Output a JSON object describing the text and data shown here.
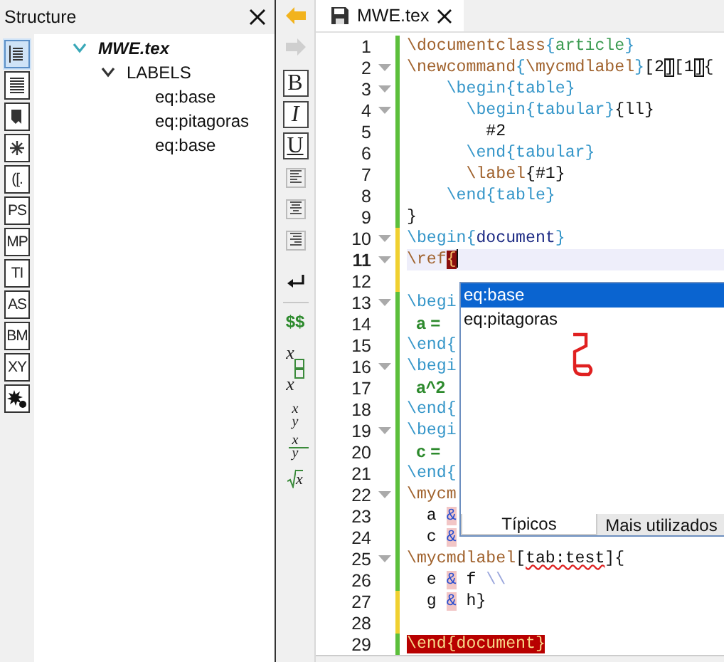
{
  "structure": {
    "title": "Structure",
    "views": [
      {
        "kind": "toc",
        "selected": true
      },
      {
        "kind": "list",
        "selected": false
      },
      {
        "kind": "bookmark",
        "selected": false
      },
      {
        "kind": "asterisk",
        "selected": false
      },
      {
        "kind": "letters",
        "label": "([.",
        "selected": false
      },
      {
        "kind": "letters",
        "label": "PS",
        "selected": false
      },
      {
        "kind": "letters",
        "label": "MP",
        "selected": false
      },
      {
        "kind": "letters",
        "label": "TI",
        "selected": false
      },
      {
        "kind": "letters",
        "label": "AS",
        "selected": false
      },
      {
        "kind": "letters",
        "label": "BM",
        "selected": false
      },
      {
        "kind": "letters",
        "label": "XY",
        "selected": false
      },
      {
        "kind": "splat",
        "selected": false
      }
    ],
    "tree": [
      {
        "label": "MWE.tex",
        "expanded": true,
        "children": [
          {
            "label": "LABELS",
            "expanded": true,
            "children": [
              {
                "label": "eq:base"
              },
              {
                "label": "eq:pitagoras"
              },
              {
                "label": "eq:base"
              }
            ]
          }
        ]
      }
    ]
  },
  "toolbar": [
    {
      "kind": "back",
      "disabled": false
    },
    {
      "kind": "forward",
      "disabled": true
    },
    {
      "kind": "bold",
      "label": "B"
    },
    {
      "kind": "italic",
      "label": "I"
    },
    {
      "kind": "underline",
      "label": "U"
    },
    {
      "kind": "align-left"
    },
    {
      "kind": "align-center"
    },
    {
      "kind": "align-right"
    },
    {
      "kind": "newline"
    },
    {
      "kind": "math",
      "label": "$$"
    },
    {
      "kind": "subscript",
      "label": "x"
    },
    {
      "kind": "superscript",
      "label": "x"
    },
    {
      "kind": "fraction",
      "numerator": "x",
      "denominator": "y"
    },
    {
      "kind": "dfrac",
      "numerator": "x",
      "denominator": "y"
    },
    {
      "kind": "sqrt",
      "label": "x"
    }
  ],
  "tabs": [
    {
      "label": "MWE.tex",
      "selected": true
    }
  ],
  "lines": [
    {
      "number": "1",
      "fold": false,
      "modified": false,
      "current": false,
      "segments": [
        {
          "kind": "command",
          "text": "\\documentclass"
        },
        {
          "kind": "environment",
          "text": "{"
        },
        {
          "kind": "argument",
          "text": "article"
        },
        {
          "kind": "environment",
          "text": "}"
        }
      ]
    },
    {
      "number": "2",
      "fold": true,
      "modified": false,
      "current": false,
      "segments": [
        {
          "kind": "command",
          "text": "\\newcommand"
        },
        {
          "kind": "environment",
          "text": "{"
        },
        {
          "kind": "command",
          "text": "\\mycmdlabel"
        },
        {
          "kind": "environment",
          "text": "}"
        },
        {
          "kind": "plain",
          "text": "[2"
        },
        {
          "kind": "match",
          "text": "]"
        },
        {
          "kind": "plain",
          "text": "[1"
        },
        {
          "kind": "match",
          "text": "]"
        },
        {
          "kind": "plain",
          "text": "{"
        }
      ]
    },
    {
      "number": "3",
      "fold": true,
      "modified": false,
      "current": false,
      "segments": [
        {
          "kind": "environment",
          "text": "    \\begin{table}"
        }
      ]
    },
    {
      "number": "4",
      "fold": true,
      "modified": false,
      "current": false,
      "segments": [
        {
          "kind": "environment",
          "text": "      \\begin{tabular}"
        },
        {
          "kind": "plain",
          "text": "{ll}"
        }
      ]
    },
    {
      "number": "5",
      "fold": false,
      "modified": false,
      "current": false,
      "segments": [
        {
          "kind": "plain",
          "text": "        #2"
        }
      ]
    },
    {
      "number": "6",
      "fold": false,
      "modified": false,
      "current": false,
      "segments": [
        {
          "kind": "environment",
          "text": "      \\end{tabular}"
        }
      ]
    },
    {
      "number": "7",
      "fold": false,
      "modified": false,
      "current": false,
      "segments": [
        {
          "kind": "command",
          "text": "      \\label"
        },
        {
          "kind": "plain",
          "text": "{#1}"
        }
      ]
    },
    {
      "number": "8",
      "fold": false,
      "modified": false,
      "current": false,
      "segments": [
        {
          "kind": "environment",
          "text": "    \\end{table}"
        }
      ]
    },
    {
      "number": "9",
      "fold": false,
      "modified": false,
      "current": false,
      "segments": [
        {
          "kind": "plain",
          "text": "}"
        }
      ]
    },
    {
      "number": "10",
      "fold": true,
      "modified": true,
      "current": false,
      "segments": [
        {
          "kind": "environment",
          "text": "\\begin{"
        },
        {
          "kind": "keyword",
          "text": "document"
        },
        {
          "kind": "environment",
          "text": "}"
        }
      ]
    },
    {
      "number": "11",
      "fold": true,
      "modified": true,
      "current": true,
      "segments": [
        {
          "kind": "command",
          "text": "\\ref"
        },
        {
          "kind": "error",
          "text": "{"
        }
      ]
    },
    {
      "number": "12",
      "fold": false,
      "modified": true,
      "current": false
    },
    {
      "number": "13",
      "fold": true,
      "modified": false,
      "current": false,
      "segments": [
        {
          "kind": "environment",
          "text": "\\begi"
        }
      ]
    },
    {
      "number": "14",
      "fold": false,
      "modified": false,
      "current": false,
      "segments": [
        {
          "kind": "math",
          "text": "  a ="
        }
      ]
    },
    {
      "number": "15",
      "fold": false,
      "modified": false,
      "current": false,
      "segments": [
        {
          "kind": "environment",
          "text": "\\end{"
        }
      ]
    },
    {
      "number": "16",
      "fold": true,
      "modified": false,
      "current": false,
      "segments": [
        {
          "kind": "environment",
          "text": "\\begi"
        }
      ]
    },
    {
      "number": "17",
      "fold": false,
      "modified": false,
      "current": false,
      "segments": [
        {
          "kind": "math",
          "text": "  a^2"
        }
      ]
    },
    {
      "number": "18",
      "fold": false,
      "modified": false,
      "current": false,
      "segments": [
        {
          "kind": "environment",
          "text": "\\end{"
        }
      ]
    },
    {
      "number": "19",
      "fold": true,
      "modified": false,
      "current": false,
      "segments": [
        {
          "kind": "environment",
          "text": "\\begi"
        }
      ]
    },
    {
      "number": "20",
      "fold": false,
      "modified": false,
      "current": false,
      "segments": [
        {
          "kind": "math",
          "text": "  c ="
        }
      ]
    },
    {
      "number": "21",
      "fold": false,
      "modified": false,
      "current": false,
      "segments": [
        {
          "kind": "environment",
          "text": "\\end{"
        }
      ]
    },
    {
      "number": "22",
      "fold": true,
      "modified": false,
      "current": false,
      "segments": [
        {
          "kind": "command",
          "text": "\\mycm"
        }
      ]
    },
    {
      "number": "23",
      "fold": false,
      "modified": false,
      "current": false,
      "segments": [
        {
          "kind": "plain",
          "text": "  a "
        },
        {
          "kind": "ampersand",
          "text": "&"
        }
      ]
    },
    {
      "number": "24",
      "fold": false,
      "modified": false,
      "current": false,
      "segments": [
        {
          "kind": "plain",
          "text": "  c "
        },
        {
          "kind": "ampersand",
          "text": "&"
        }
      ]
    },
    {
      "number": "25",
      "fold": true,
      "modified": false,
      "current": false,
      "segments": [
        {
          "kind": "command",
          "text": "\\mycmdlabel"
        },
        {
          "kind": "plain",
          "text": "["
        },
        {
          "kind": "misspelled",
          "text": "tab:test"
        },
        {
          "kind": "plain",
          "text": "]{"
        }
      ]
    },
    {
      "number": "26",
      "fold": false,
      "modified": false,
      "current": false,
      "segments": [
        {
          "kind": "plain",
          "text": "  e "
        },
        {
          "kind": "ampersand",
          "text": "&"
        },
        {
          "kind": "plain",
          "text": " f "
        },
        {
          "kind": "linebreak",
          "text": "\\\\"
        }
      ]
    },
    {
      "number": "27",
      "fold": false,
      "modified": true,
      "current": false,
      "segments": [
        {
          "kind": "plain",
          "text": "  g "
        },
        {
          "kind": "ampersand",
          "text": "&"
        },
        {
          "kind": "plain",
          "text": " h}"
        }
      ]
    },
    {
      "number": "28",
      "fold": false,
      "modified": true,
      "current": false
    },
    {
      "number": "29",
      "fold": false,
      "modified": false,
      "current": false,
      "segments": [
        {
          "kind": "unmatched",
          "text": "\\end{document}"
        }
      ]
    }
  ],
  "completion": {
    "items": [
      {
        "label": "eq:base",
        "selected": true
      },
      {
        "label": "eq:pitagoras",
        "selected": false
      }
    ],
    "tabs": [
      {
        "label": "Típicos",
        "selected": true
      },
      {
        "label": "Mais utilizados",
        "selected": false
      }
    ]
  }
}
